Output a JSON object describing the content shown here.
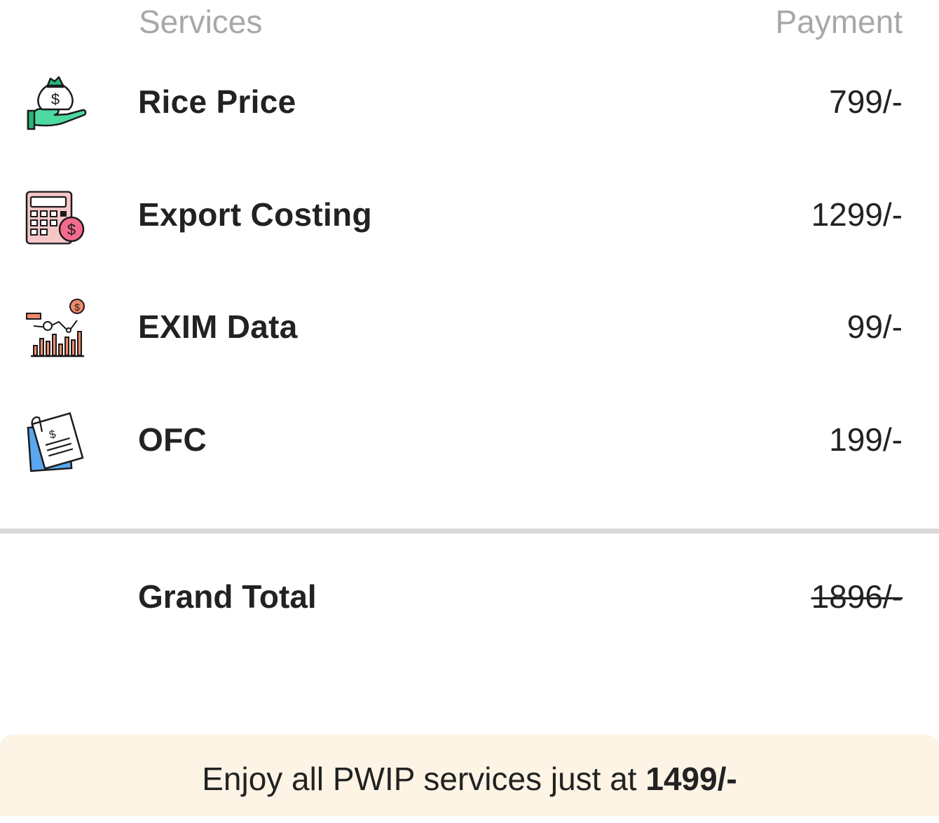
{
  "header": {
    "services_label": "Services",
    "payment_label": "Payment"
  },
  "services": [
    {
      "icon": "money-bag-hand-icon",
      "label": "Rice Price",
      "price": "799/-"
    },
    {
      "icon": "calculator-dollar-icon",
      "label": "Export Costing",
      "price": "1299/-"
    },
    {
      "icon": "analytics-chart-icon",
      "label": "EXIM Data",
      "price": "99/-"
    },
    {
      "icon": "invoice-document-icon",
      "label": "OFC",
      "price": "199/-"
    }
  ],
  "total": {
    "label": "Grand Total",
    "original_price": "1896/-"
  },
  "offer": {
    "text": "Enjoy all PWIP services just at ",
    "amount": "1499/-"
  },
  "colors": {
    "header_text": "#a8a8a8",
    "offer_background": "#fdf4e5",
    "divider": "#d9d9d9"
  }
}
